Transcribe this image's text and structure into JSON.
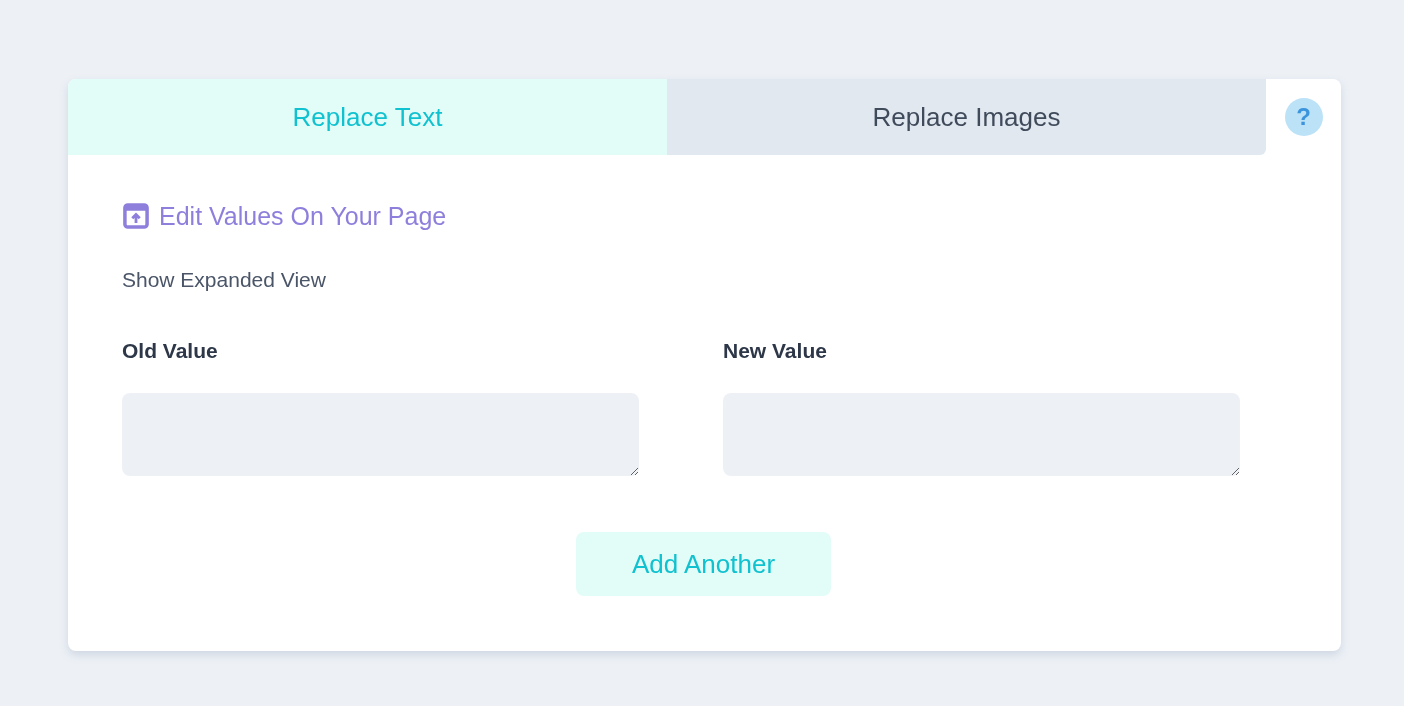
{
  "tabs": [
    {
      "label": "Replace Text",
      "selected": true
    },
    {
      "label": "Replace Images",
      "selected": false
    }
  ],
  "help": {
    "glyph": "?"
  },
  "edit_link": {
    "label": "Edit Values On Your Page"
  },
  "expand_toggle": {
    "label": "Show Expanded View"
  },
  "fields": [
    {
      "label": "Old Value"
    },
    {
      "label": "New Value"
    }
  ],
  "add_button": {
    "label": "Add Another"
  }
}
